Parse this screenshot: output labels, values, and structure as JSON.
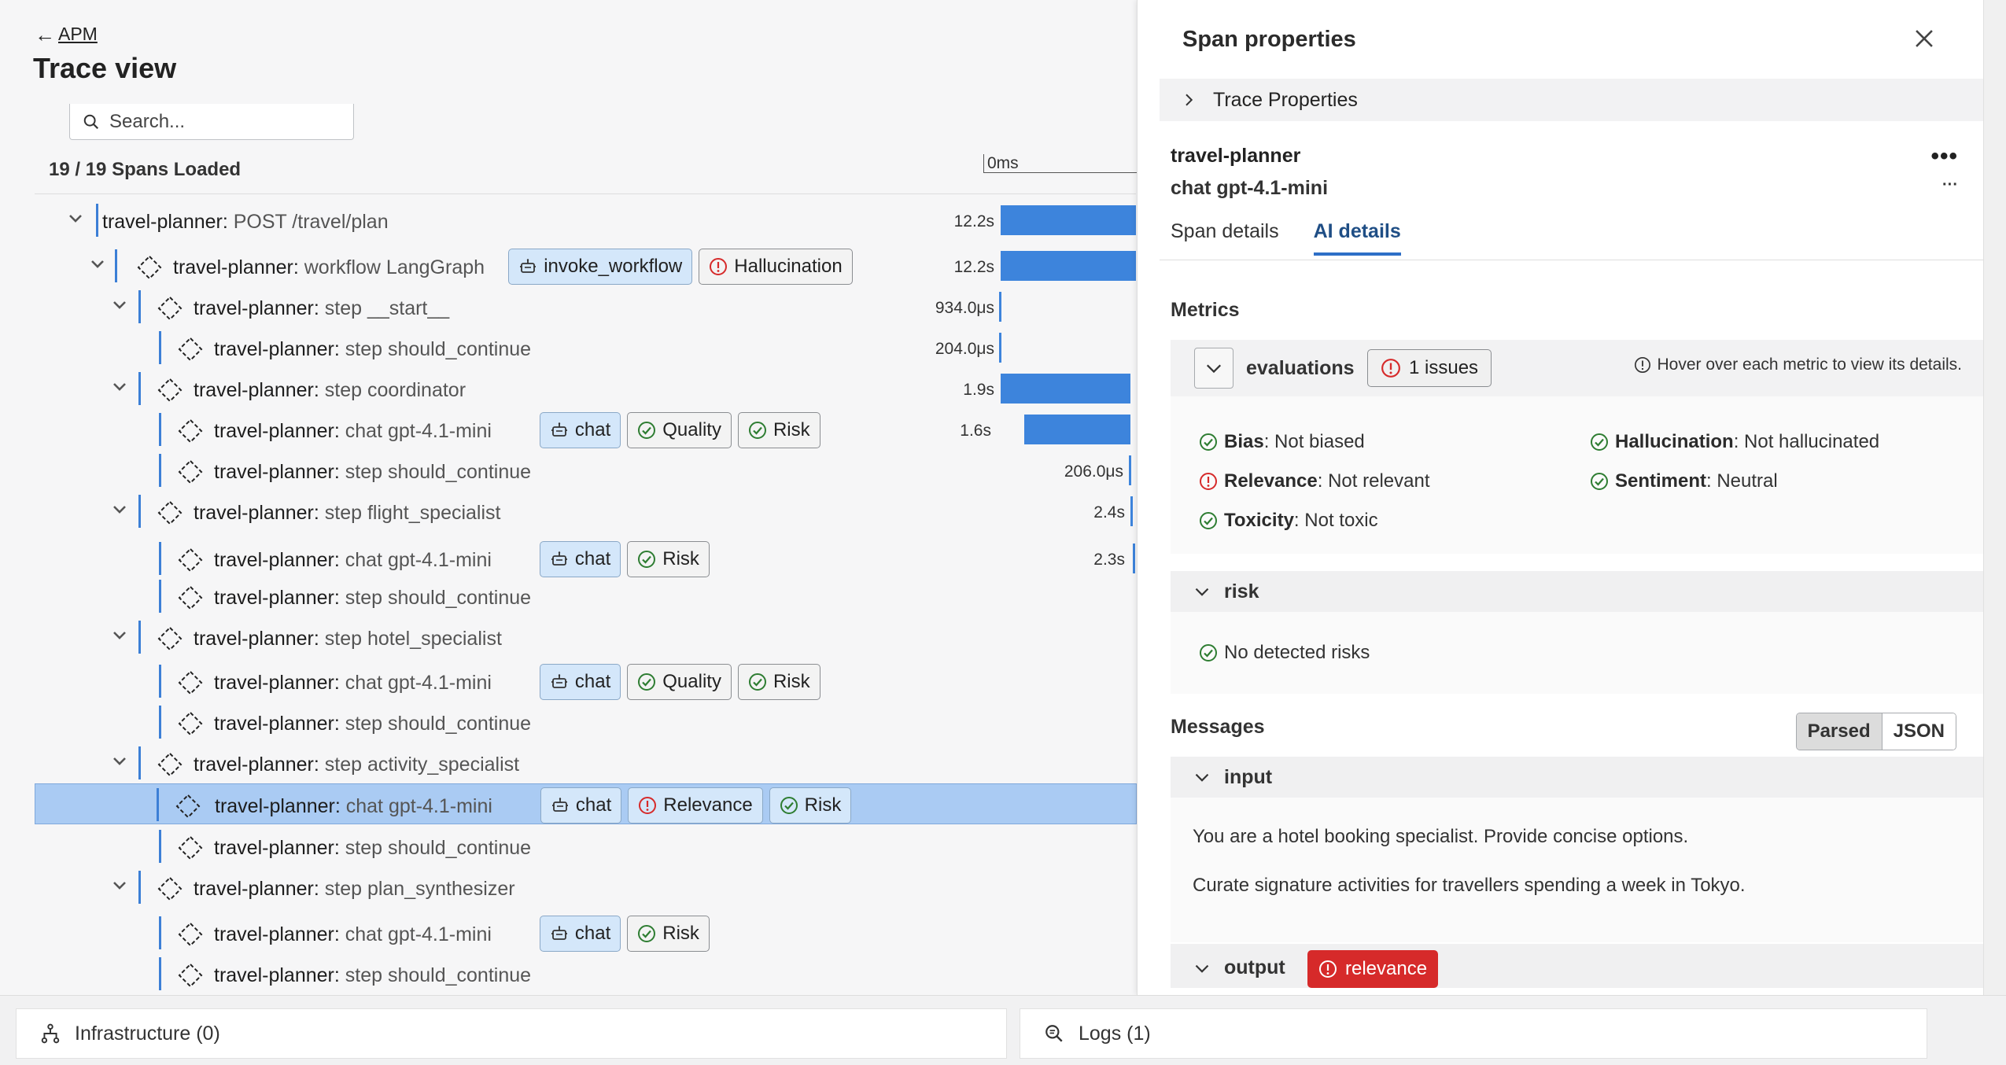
{
  "header": {
    "back_label": "APM",
    "title": "Trace view",
    "search_placeholder": "Search...",
    "spans_loaded": "19 / 19 Spans Loaded",
    "timeline_start": "0ms"
  },
  "spans": [
    {
      "service": "travel-planner:",
      "op": "POST /travel/plan",
      "duration": "12.2s",
      "tags": []
    },
    {
      "service": "travel-planner:",
      "op": "workflow LangGraph",
      "duration": "12.2s",
      "tags": [
        {
          "label": "invoke_workflow",
          "icon": "robot-icon",
          "style": "blue"
        },
        {
          "label": "Hallucination",
          "icon": "alert-circle-icon",
          "style": "plain"
        }
      ]
    },
    {
      "service": "travel-planner:",
      "op": "step __start__",
      "duration": "934.0μs",
      "tags": []
    },
    {
      "service": "travel-planner:",
      "op": "step should_continue",
      "duration": "204.0μs",
      "tags": []
    },
    {
      "service": "travel-planner:",
      "op": "step coordinator",
      "duration": "1.9s",
      "tags": []
    },
    {
      "service": "travel-planner:",
      "op": "chat gpt-4.1-mini",
      "duration": "1.6s",
      "tags": [
        {
          "label": "chat",
          "icon": "robot-icon",
          "style": "blue"
        },
        {
          "label": "Quality",
          "icon": "check-circle-icon",
          "style": "plain"
        },
        {
          "label": "Risk",
          "icon": "check-circle-icon",
          "style": "plain"
        }
      ]
    },
    {
      "service": "travel-planner:",
      "op": "step should_continue",
      "duration": "206.0μs",
      "tags": []
    },
    {
      "service": "travel-planner:",
      "op": "step flight_specialist",
      "duration": "2.4s",
      "tags": []
    },
    {
      "service": "travel-planner:",
      "op": "chat gpt-4.1-mini",
      "duration": "2.3s",
      "tags": [
        {
          "label": "chat",
          "icon": "robot-icon",
          "style": "blue"
        },
        {
          "label": "Risk",
          "icon": "check-circle-icon",
          "style": "plain"
        }
      ]
    },
    {
      "service": "travel-planner:",
      "op": "step should_continue",
      "duration": "",
      "tags": []
    },
    {
      "service": "travel-planner:",
      "op": "step hotel_specialist",
      "duration": "",
      "tags": []
    },
    {
      "service": "travel-planner:",
      "op": "chat gpt-4.1-mini",
      "duration": "",
      "tags": [
        {
          "label": "chat",
          "icon": "robot-icon",
          "style": "blue"
        },
        {
          "label": "Quality",
          "icon": "check-circle-icon",
          "style": "plain"
        },
        {
          "label": "Risk",
          "icon": "check-circle-icon",
          "style": "plain"
        }
      ]
    },
    {
      "service": "travel-planner:",
      "op": "step should_continue",
      "duration": "",
      "tags": []
    },
    {
      "service": "travel-planner:",
      "op": "step activity_specialist",
      "duration": "",
      "tags": []
    },
    {
      "service": "travel-planner:",
      "op": "chat gpt-4.1-mini",
      "duration": "",
      "selected": true,
      "tags": [
        {
          "label": "chat",
          "icon": "robot-icon",
          "style": "blue"
        },
        {
          "label": "Relevance",
          "icon": "alert-circle-icon",
          "style": "blue"
        },
        {
          "label": "Risk",
          "icon": "check-circle-icon",
          "style": "blue"
        }
      ]
    },
    {
      "service": "travel-planner:",
      "op": "step should_continue",
      "duration": "",
      "tags": []
    },
    {
      "service": "travel-planner:",
      "op": "step plan_synthesizer",
      "duration": "",
      "tags": []
    },
    {
      "service": "travel-planner:",
      "op": "chat gpt-4.1-mini",
      "duration": "",
      "tags": [
        {
          "label": "chat",
          "icon": "robot-icon",
          "style": "blue"
        },
        {
          "label": "Risk",
          "icon": "check-circle-icon",
          "style": "plain"
        }
      ]
    },
    {
      "service": "travel-planner:",
      "op": "step should_continue",
      "duration": "",
      "tags": []
    }
  ],
  "panel": {
    "title": "Span properties",
    "trace_properties": "Trace Properties",
    "service_name": "travel-planner",
    "operation_name": "chat gpt-4.1-mini",
    "more_label": "•••",
    "more_small": "···",
    "tabs": [
      {
        "label": "Span details",
        "active": false
      },
      {
        "label": "AI details",
        "active": true
      }
    ],
    "metrics_heading": "Metrics",
    "evaluations_label": "evaluations",
    "issues_label": "1 issues",
    "hover_hint": "Hover over each metric to view its details.",
    "metrics": [
      {
        "name": "Bias",
        "value": " : Not biased",
        "status": "ok"
      },
      {
        "name": "Hallucination",
        "value": " : Not hallucinated",
        "status": "ok"
      },
      {
        "name": "Relevance",
        "value": " : Not relevant",
        "status": "fail"
      },
      {
        "name": "Sentiment",
        "value": " : Neutral",
        "status": "ok"
      },
      {
        "name": "Toxicity",
        "value": " : Not toxic",
        "status": "ok"
      }
    ],
    "risk_label": "risk",
    "risk_result": "No detected risks",
    "messages_heading": "Messages",
    "view_parsed": "Parsed",
    "view_json": "JSON",
    "input_label": "input",
    "input_lines": [
      "You are a hotel booking specialist. Provide concise options.",
      "Curate signature activities for travellers spending a week in Tokyo."
    ],
    "output_label": "output",
    "output_tag": "relevance"
  },
  "bottom": {
    "infrastructure": "Infrastructure (0)",
    "logs": "Logs (1)"
  },
  "colors": {
    "accent": "#3d84dc",
    "selected_row": "#aacbf3",
    "danger": "#d62a2a",
    "ok": "#2e7d32"
  }
}
